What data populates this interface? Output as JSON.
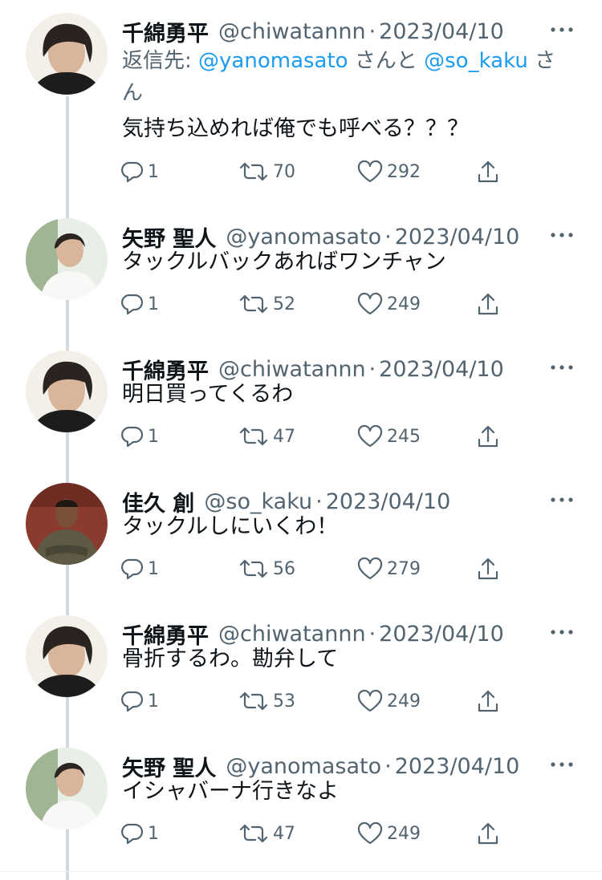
{
  "tweets": [
    {
      "name": "千綿勇平",
      "handle": "@chiwatannn",
      "sep": "·",
      "date": "2023/04/10",
      "reply_prefix": "返信先: ",
      "reply_user1": "@yanomasato",
      "reply_mid": " さんと ",
      "reply_user2": "@so_kaku",
      "reply_suffix": " さん",
      "text": "気持ち込めれば俺でも呼べる？？？",
      "replies": "1",
      "retweets": "70",
      "likes": "292",
      "avatar": "chiwata-avatar"
    },
    {
      "name": "矢野 聖人",
      "handle": "@yanomasato",
      "sep": "·",
      "date": "2023/04/10",
      "text": "タックルバックあればワンチャン",
      "replies": "1",
      "retweets": "52",
      "likes": "249",
      "avatar": "yano-avatar"
    },
    {
      "name": "千綿勇平",
      "handle": "@chiwatannn",
      "sep": "·",
      "date": "2023/04/10",
      "text": "明日買ってくるわ",
      "replies": "1",
      "retweets": "47",
      "likes": "245",
      "avatar": "chiwata-avatar"
    },
    {
      "name": "佳久 創",
      "handle": "@so_kaku",
      "sep": "·",
      "date": "2023/04/10",
      "text": "タックルしにいくわ！",
      "replies": "1",
      "retweets": "56",
      "likes": "279",
      "avatar": "sokaku-avatar"
    },
    {
      "name": "千綿勇平",
      "handle": "@chiwatannn",
      "sep": "·",
      "date": "2023/04/10",
      "text": "骨折するわ。勘弁して",
      "replies": "1",
      "retweets": "53",
      "likes": "249",
      "avatar": "chiwata-avatar"
    },
    {
      "name": "矢野 聖人",
      "handle": "@yanomasato",
      "sep": "·",
      "date": "2023/04/10",
      "text": "イシャバーナ行きなよ",
      "replies": "1",
      "retweets": "47",
      "likes": "249",
      "avatar": "yano-avatar"
    }
  ],
  "colors": {
    "text": "#0f1419",
    "muted": "#536471",
    "link": "#1d9bf0",
    "thread": "#cfd9de"
  }
}
